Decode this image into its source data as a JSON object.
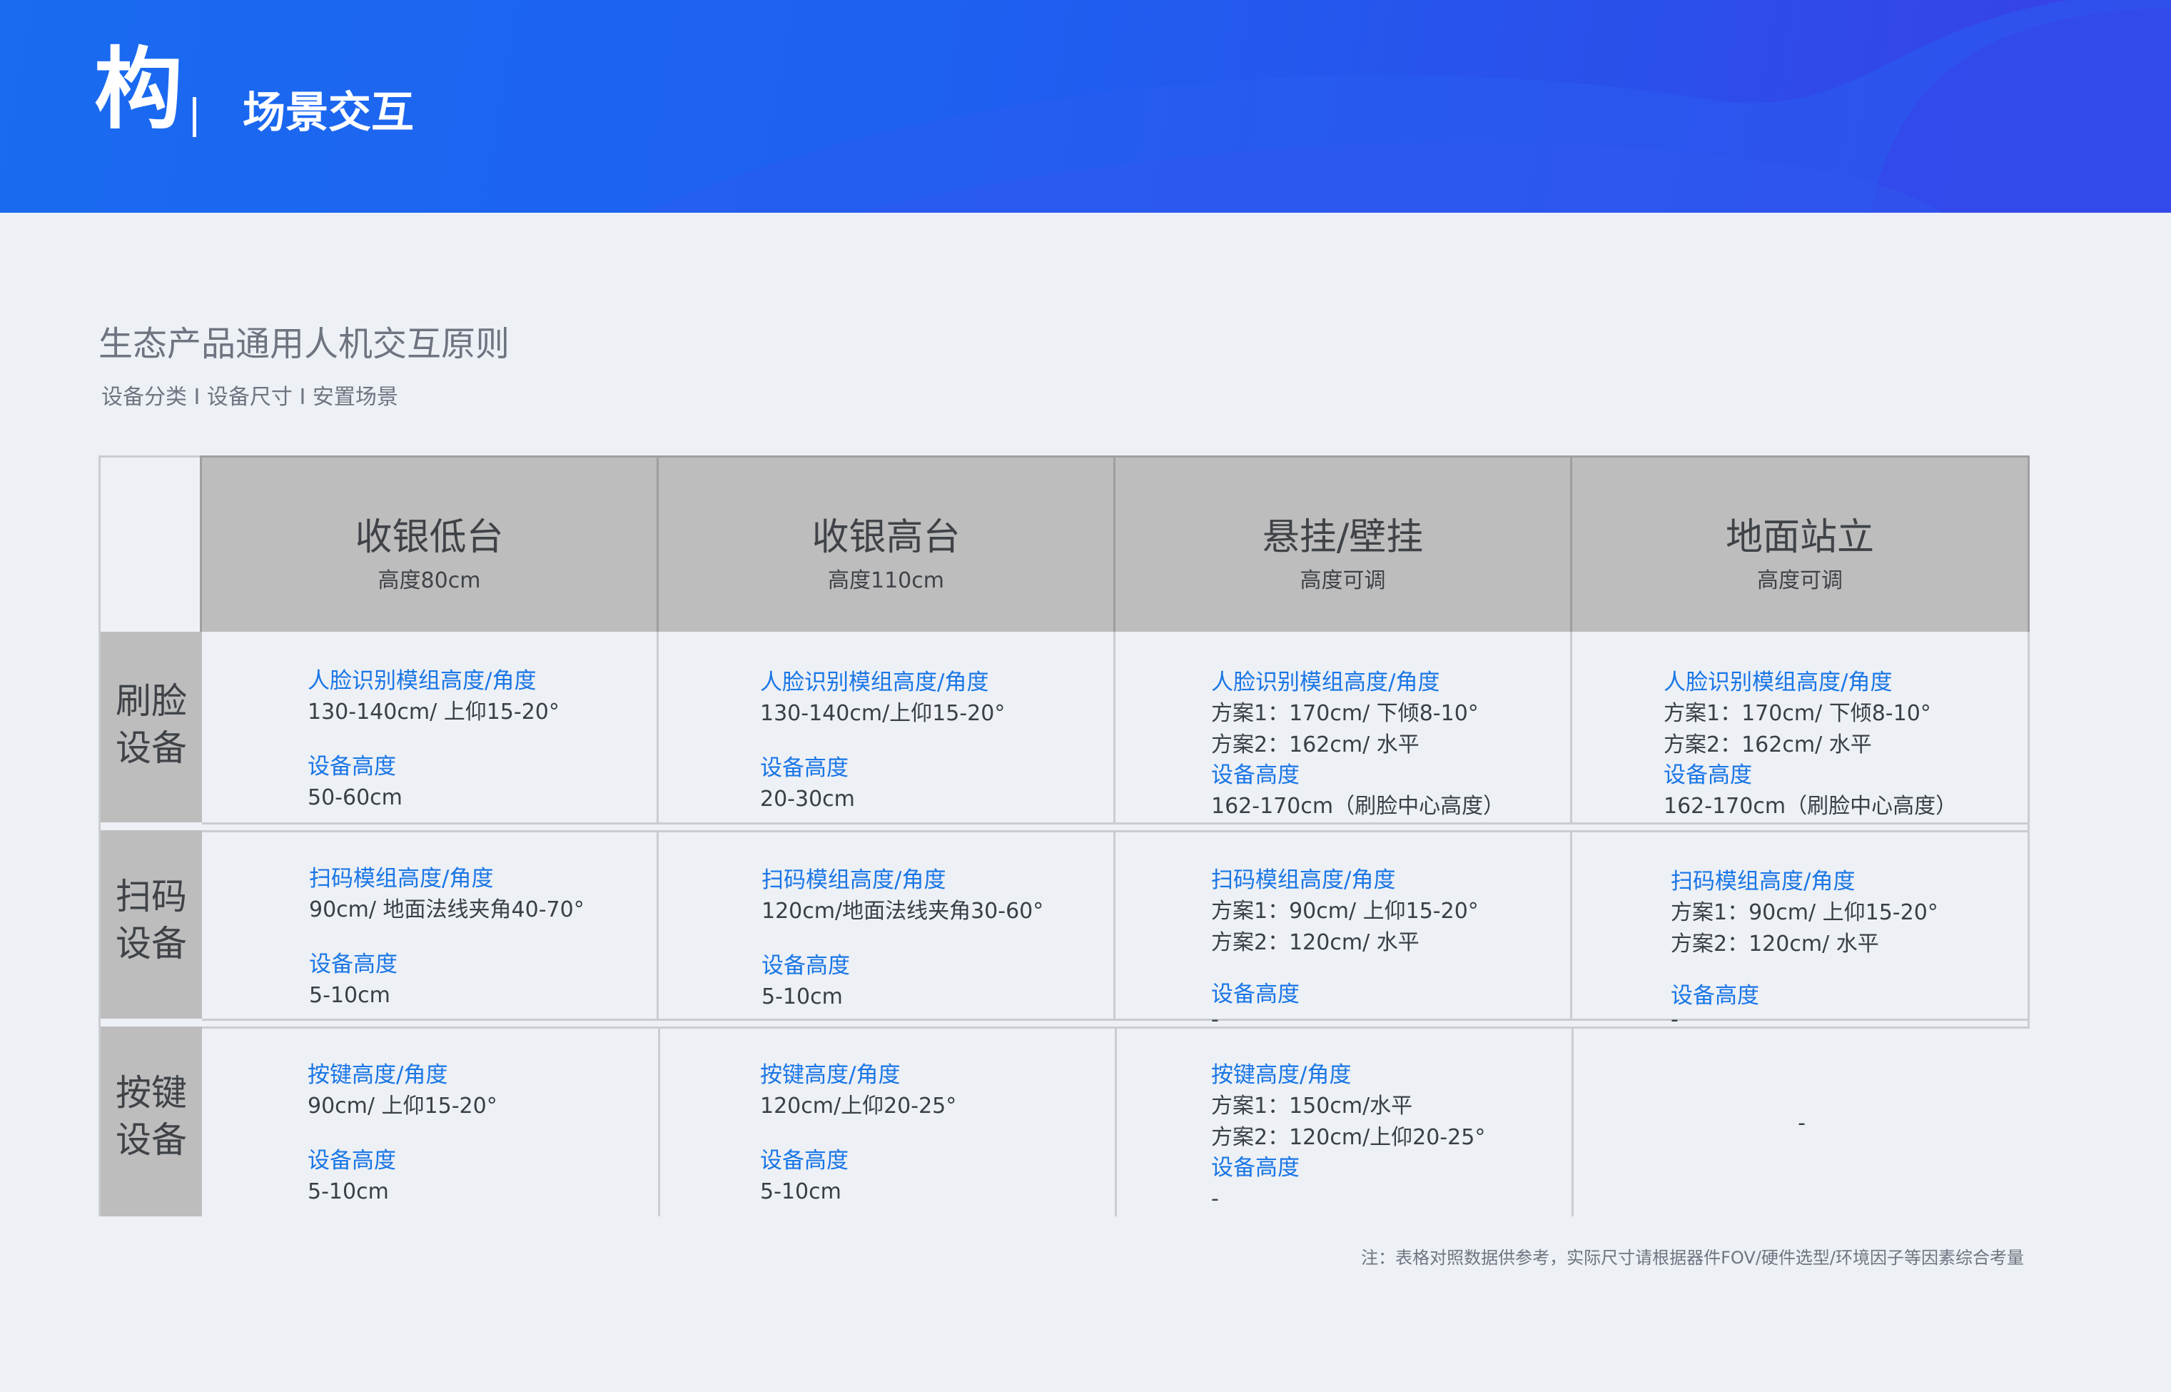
{
  "header": {
    "brand_char": "构",
    "separator": "|",
    "subtitle": "场景交互"
  },
  "section": {
    "title": "生态产品通用人机交互原则",
    "subtitle": "设备分类 I 设备尺寸 I 安置场景"
  },
  "columns": [
    {
      "title": "收银低台",
      "sub": "高度80cm"
    },
    {
      "title": "收银高台",
      "sub": "高度110cm"
    },
    {
      "title": "悬挂/壁挂",
      "sub": "高度可调"
    },
    {
      "title": "地面站立",
      "sub": "高度可调"
    }
  ],
  "rows": [
    {
      "label_line1": "刷脸",
      "label_line2": "设备"
    },
    {
      "label_line1": "扫码",
      "label_line2": "设备"
    },
    {
      "label_line1": "按键",
      "label_line2": "设备"
    }
  ],
  "cells": {
    "r0c0": {
      "t1": "人脸识别模组高度/角度",
      "v1": "130-140cm/ 上仰15-20°",
      "t2": "设备高度",
      "v2": "50-60cm"
    },
    "r0c1": {
      "t1": "人脸识别模组高度/角度",
      "v1": "130-140cm/上仰15-20°",
      "t2": "设备高度",
      "v2": "20-30cm"
    },
    "r0c2": {
      "t1": "人脸识别模组高度/角度",
      "v1a": "方案1：170cm/ 下倾8-10°",
      "v1b": "方案2：162cm/ 水平",
      "t2": "设备高度",
      "v2": "162-170cm（刷脸中心高度）"
    },
    "r0c3": {
      "t1": "人脸识别模组高度/角度",
      "v1a": "方案1：170cm/ 下倾8-10°",
      "v1b": "方案2：162cm/ 水平",
      "t2": "设备高度",
      "v2": "162-170cm（刷脸中心高度）"
    },
    "r1c0": {
      "t1": "扫码模组高度/角度",
      "v1": "90cm/ 地面法线夹角40-70°",
      "t2": "设备高度",
      "v2": "5-10cm"
    },
    "r1c1": {
      "t1": "扫码模组高度/角度",
      "v1": "120cm/地面法线夹角30-60°",
      "t2": "设备高度",
      "v2": "5-10cm"
    },
    "r1c2": {
      "t1": "扫码模组高度/角度",
      "v1a": "方案1：90cm/ 上仰15-20°",
      "v1b": "方案2：120cm/ 水平",
      "t2": "设备高度",
      "v2": "-"
    },
    "r1c3": {
      "t1": "扫码模组高度/角度",
      "v1a": "方案1：90cm/ 上仰15-20°",
      "v1b": "方案2：120cm/ 水平",
      "t2": "设备高度",
      "v2": "-"
    },
    "r2c0": {
      "t1": "按键高度/角度",
      "v1": "90cm/ 上仰15-20°",
      "t2": "设备高度",
      "v2": "5-10cm"
    },
    "r2c1": {
      "t1": "按键高度/角度",
      "v1": "120cm/上仰20-25°",
      "t2": "设备高度",
      "v2": "5-10cm"
    },
    "r2c2": {
      "t1": "按键高度/角度",
      "v1a": "方案1：150cm/水平",
      "v1b": "方案2：120cm/上仰20-25°",
      "t2": "设备高度",
      "v2": "-"
    },
    "r2c3": {
      "empty": "-"
    }
  },
  "footnote": "注：表格对照数据供参考，实际尺寸请根据器件FOV/硬件选型/环境因子等因素综合考量",
  "colors": {
    "banner_start": "#1a6bf0",
    "banner_end": "#3a3fe6",
    "page_bg": "#edf0f5",
    "header_gray": "#bdbdbd",
    "accent_blue": "#1976e6",
    "text_gray": "#3a3f46"
  }
}
